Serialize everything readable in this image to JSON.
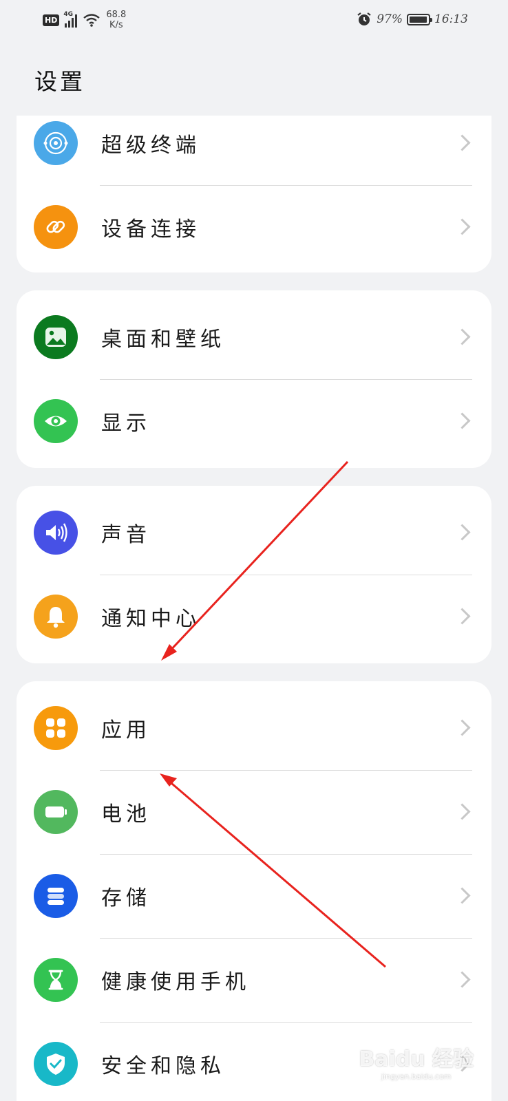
{
  "status_bar": {
    "hd": "HD",
    "network_type": "4G",
    "speed_value": "68.8",
    "speed_unit": "K/s",
    "battery_percent": "97%",
    "time": "16:13"
  },
  "page": {
    "title": "设置"
  },
  "groups": [
    {
      "items": [
        {
          "label": "超级终端",
          "icon": "super-device-icon",
          "color": "#4aa8e8"
        },
        {
          "label": "设备连接",
          "icon": "link-icon",
          "color": "#f5920f"
        }
      ]
    },
    {
      "items": [
        {
          "label": "桌面和壁纸",
          "icon": "wallpaper-icon",
          "color": "#0b7a1f"
        },
        {
          "label": "显示",
          "icon": "eye-icon",
          "color": "#33c352"
        }
      ]
    },
    {
      "items": [
        {
          "label": "声音",
          "icon": "speaker-icon",
          "color": "#4751e6"
        },
        {
          "label": "通知中心",
          "icon": "bell-icon",
          "color": "#f5a21c"
        }
      ]
    },
    {
      "items": [
        {
          "label": "应用",
          "icon": "apps-icon",
          "color": "#f79a0c"
        },
        {
          "label": "电池",
          "icon": "battery-icon",
          "color": "#52b85e"
        },
        {
          "label": "存储",
          "icon": "storage-icon",
          "color": "#1a5ce6"
        },
        {
          "label": "健康使用手机",
          "icon": "hourglass-icon",
          "color": "#33c352"
        },
        {
          "label": "安全和隐私",
          "icon": "shield-icon",
          "color": "#18b8c8"
        }
      ]
    }
  ],
  "watermark": {
    "text": "Baidu 经验",
    "sub": "jingyan.baidu.com"
  },
  "colors": {
    "background": "#f1f2f4",
    "card": "#ffffff",
    "annotation_arrow": "#e8231e"
  }
}
